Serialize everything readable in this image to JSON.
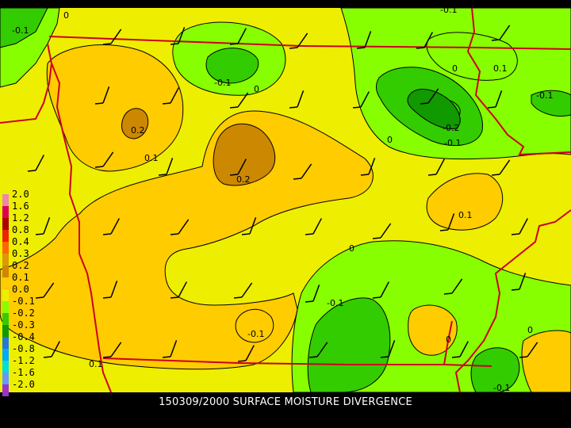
{
  "caption": "150309/2000 SURFACE MOISTURE DIVERGENCE",
  "colors": {
    "background": "#000000",
    "fill_0_to_0.1": "#eeee00",
    "fill_0.1_to_0.2": "#ffcc00",
    "fill_0.2_to_0.3": "#cc8800",
    "fill_-0.1_to_0": "#88ff00",
    "fill_-0.2_to_-0.1": "#33cc00",
    "fill_-0.3_to_-0.2": "#119900",
    "boundaries": "#cc0022",
    "contours": "#000000",
    "wind_barbs": "#000000"
  },
  "legend": {
    "levels": [
      {
        "label": "2.0",
        "color": "#ee88aa"
      },
      {
        "label": "1.6",
        "color": "#dd0055"
      },
      {
        "label": "1.2",
        "color": "#aa0000"
      },
      {
        "label": "0.8",
        "color": "#ee2200"
      },
      {
        "label": "0.4",
        "color": "#ff6600"
      },
      {
        "label": "0.3",
        "color": "#dd9900"
      },
      {
        "label": "0.2",
        "color": "#cc8800"
      },
      {
        "label": "0.1",
        "color": "#ffcc00"
      },
      {
        "label": "0.0",
        "color": "#eeee00"
      },
      {
        "label": "-0.1",
        "color": "#88ff00"
      },
      {
        "label": "-0.2",
        "color": "#33cc00"
      },
      {
        "label": "-0.3",
        "color": "#119900"
      },
      {
        "label": "-0.4",
        "color": "#2277dd"
      },
      {
        "label": "-0.8",
        "color": "#00aaff"
      },
      {
        "label": "-1.2",
        "color": "#00dddd"
      },
      {
        "label": "-1.6",
        "color": "#6699ff"
      },
      {
        "label": "-2.0",
        "color": "#9933cc"
      }
    ]
  },
  "contour_labels": [
    "0",
    "-0.1",
    "-0.1",
    "0",
    "0.1",
    "-0.1",
    "0.2",
    "0.1",
    "-0.1",
    "-0.2",
    "-0.1",
    "0",
    "0.2",
    "0.1",
    "0",
    "-0.1",
    "-0.1",
    "0",
    "0.1",
    "0",
    "-0.1",
    "0"
  ]
}
